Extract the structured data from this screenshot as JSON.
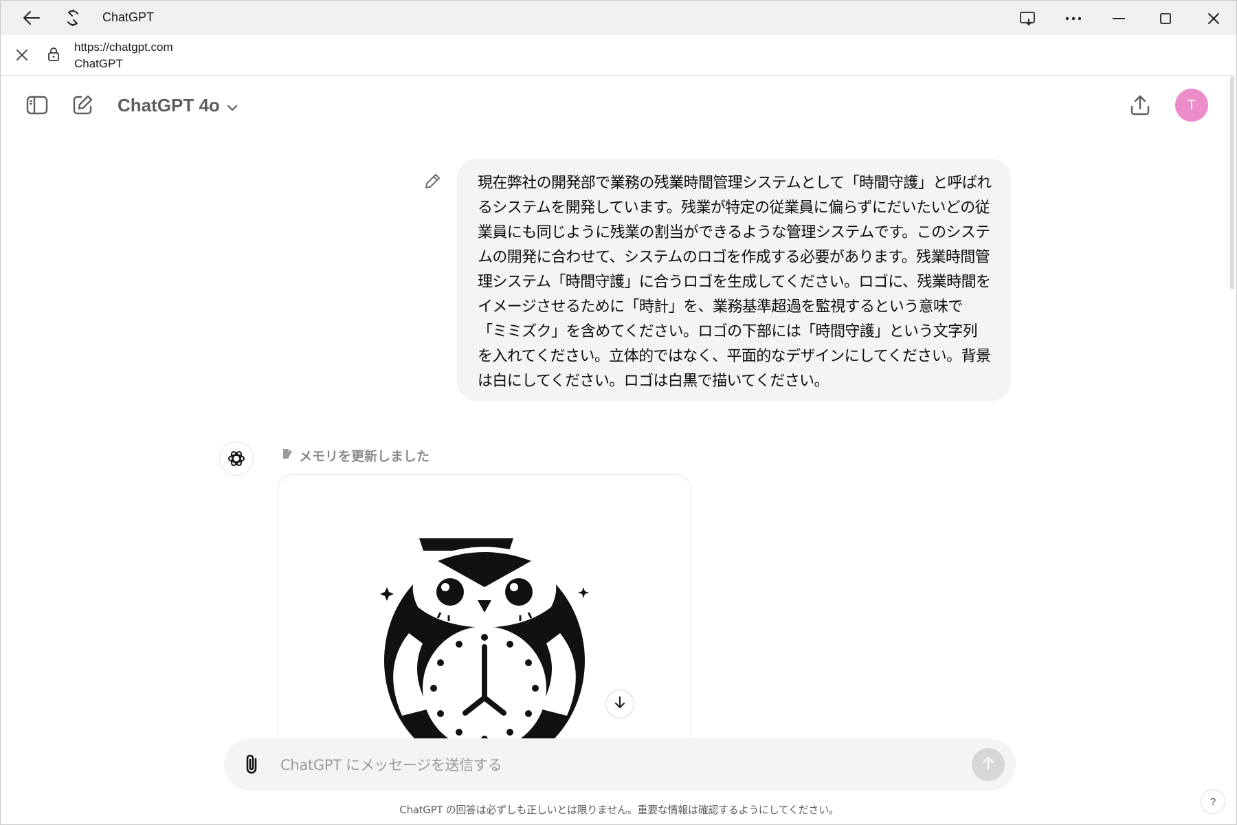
{
  "browser": {
    "title": "ChatGPT",
    "url": "https://chatgpt.com",
    "site_name": "ChatGPT"
  },
  "header": {
    "model_name": "ChatGPT 4o",
    "avatar_initial": "T",
    "avatar_color": "#ec8cc8"
  },
  "conversation": {
    "user_message": "現在弊社の開発部で業務の残業時間管理システムとして「時間守護」と呼ばれるシステムを開発しています。残業が特定の従業員に偏らずにだいたいどの従業員にも同じように残業の割当ができるような管理システムです。このシステムの開発に合わせて、システムのロゴを作成する必要があります。残業時間管理システム「時間守護」に合うロゴを生成してください。ロゴに、残業時間をイメージさせるために「時計」を、業務基準超過を監視するという意味で「ミミズク」を含めてください。ロゴの下部には「時間守護」という文字列を入れてください。立体的ではなく、平面的なデザインにしてください。背景は白にしてください。ロゴは白黒で描いてください。",
    "memory_note": "メモリを更新しました"
  },
  "composer": {
    "placeholder": "ChatGPT にメッセージを送信する"
  },
  "footer": {
    "disclaimer": "ChatGPT の回答は必ずしも正しいとは限りません。重要な情報は確認するようにしてください。",
    "help_label": "?"
  },
  "icons": {
    "back": "arrow-left-icon",
    "refresh": "refresh-icon",
    "cast": "cast-icon",
    "more": "more-horizontal-icon",
    "minimize": "minimize-icon",
    "maximize": "maximize-icon",
    "close": "close-icon",
    "lock": "lock-icon",
    "sidebar": "sidebar-toggle-icon",
    "new_chat": "new-chat-icon",
    "share": "share-icon",
    "edit": "pencil-icon",
    "openai": "openai-logo-icon",
    "memory": "memory-icon",
    "scroll_down": "arrow-down-icon",
    "attach": "paperclip-icon",
    "send": "arrow-up-icon"
  }
}
